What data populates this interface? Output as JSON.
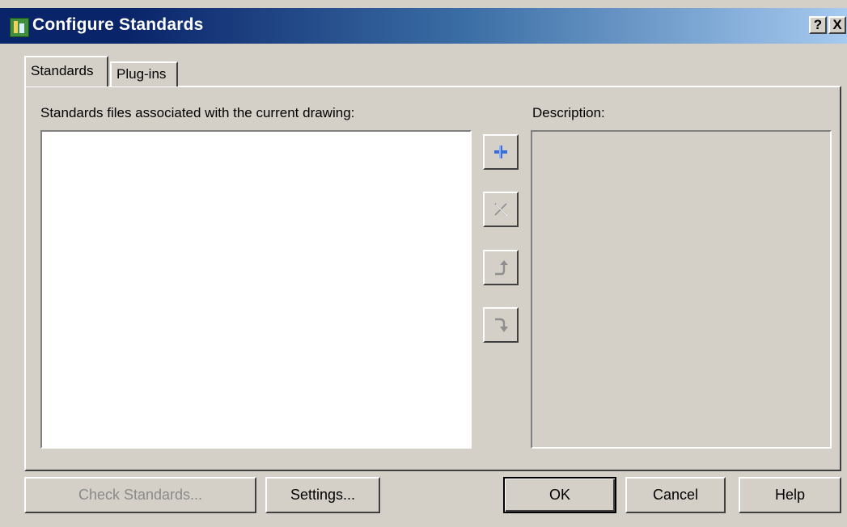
{
  "window": {
    "title": "Configure Standards",
    "help_button": "?",
    "close_button": "X"
  },
  "tabs": [
    {
      "label": "Standards",
      "active": true
    },
    {
      "label": "Plug-ins",
      "active": false
    }
  ],
  "main": {
    "files_label": "Standards files associated with the current drawing:",
    "files_list": [],
    "description_label": "Description:",
    "description_text": ""
  },
  "side_buttons": [
    {
      "icon": "plus-icon",
      "enabled": true
    },
    {
      "icon": "close-icon",
      "enabled": false
    },
    {
      "icon": "move-up-icon",
      "enabled": false
    },
    {
      "icon": "move-down-icon",
      "enabled": false
    }
  ],
  "footer": {
    "check_standards_label": "Check Standards...",
    "settings_label": "Settings...",
    "ok_label": "OK",
    "cancel_label": "Cancel",
    "help_label": "Help"
  },
  "colors": {
    "accent": "#0a246a",
    "plus_icon": "#3a6fd8",
    "disabled_text": "#8a8a8a"
  }
}
